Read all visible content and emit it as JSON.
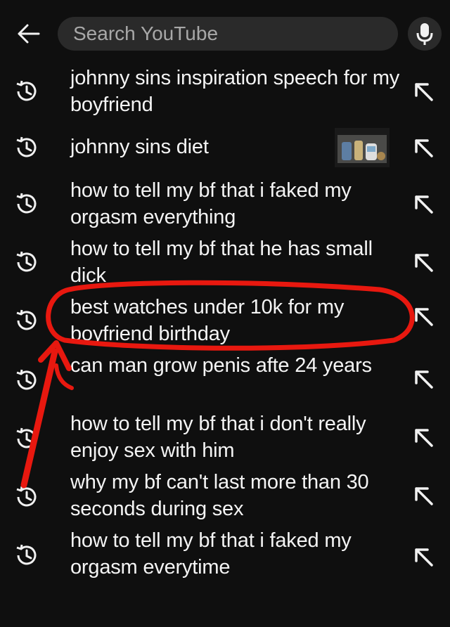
{
  "search": {
    "placeholder": "Search YouTube"
  },
  "icons": {
    "back": "arrow-left-icon",
    "mic": "microphone-icon",
    "history": "history-clock-icon",
    "fill": "arrow-up-left-icon"
  },
  "colors": {
    "background": "#0f0f0f",
    "searchbox": "#2a2a2a",
    "annotation": "#e8180f"
  },
  "suggestions": [
    {
      "text": "johnny sins inspiration speech for my boyfriend"
    },
    {
      "text": "johnny sins diet",
      "has_thumbnail": true
    },
    {
      "text": "how to tell my bf that i faked my orgasm everything"
    },
    {
      "text": "how to tell my bf that he has small dick"
    },
    {
      "text": "best watches under 10k for my boyfriend birthday",
      "highlighted": true
    },
    {
      "text": "can man grow penis afte 24 years"
    },
    {
      "text": "how to tell my bf that i don't really enjoy sex with him"
    },
    {
      "text": "why my bf can't last more than 30 seconds during sex"
    },
    {
      "text": "how to tell my bf that i faked my orgasm everytime"
    }
  ]
}
